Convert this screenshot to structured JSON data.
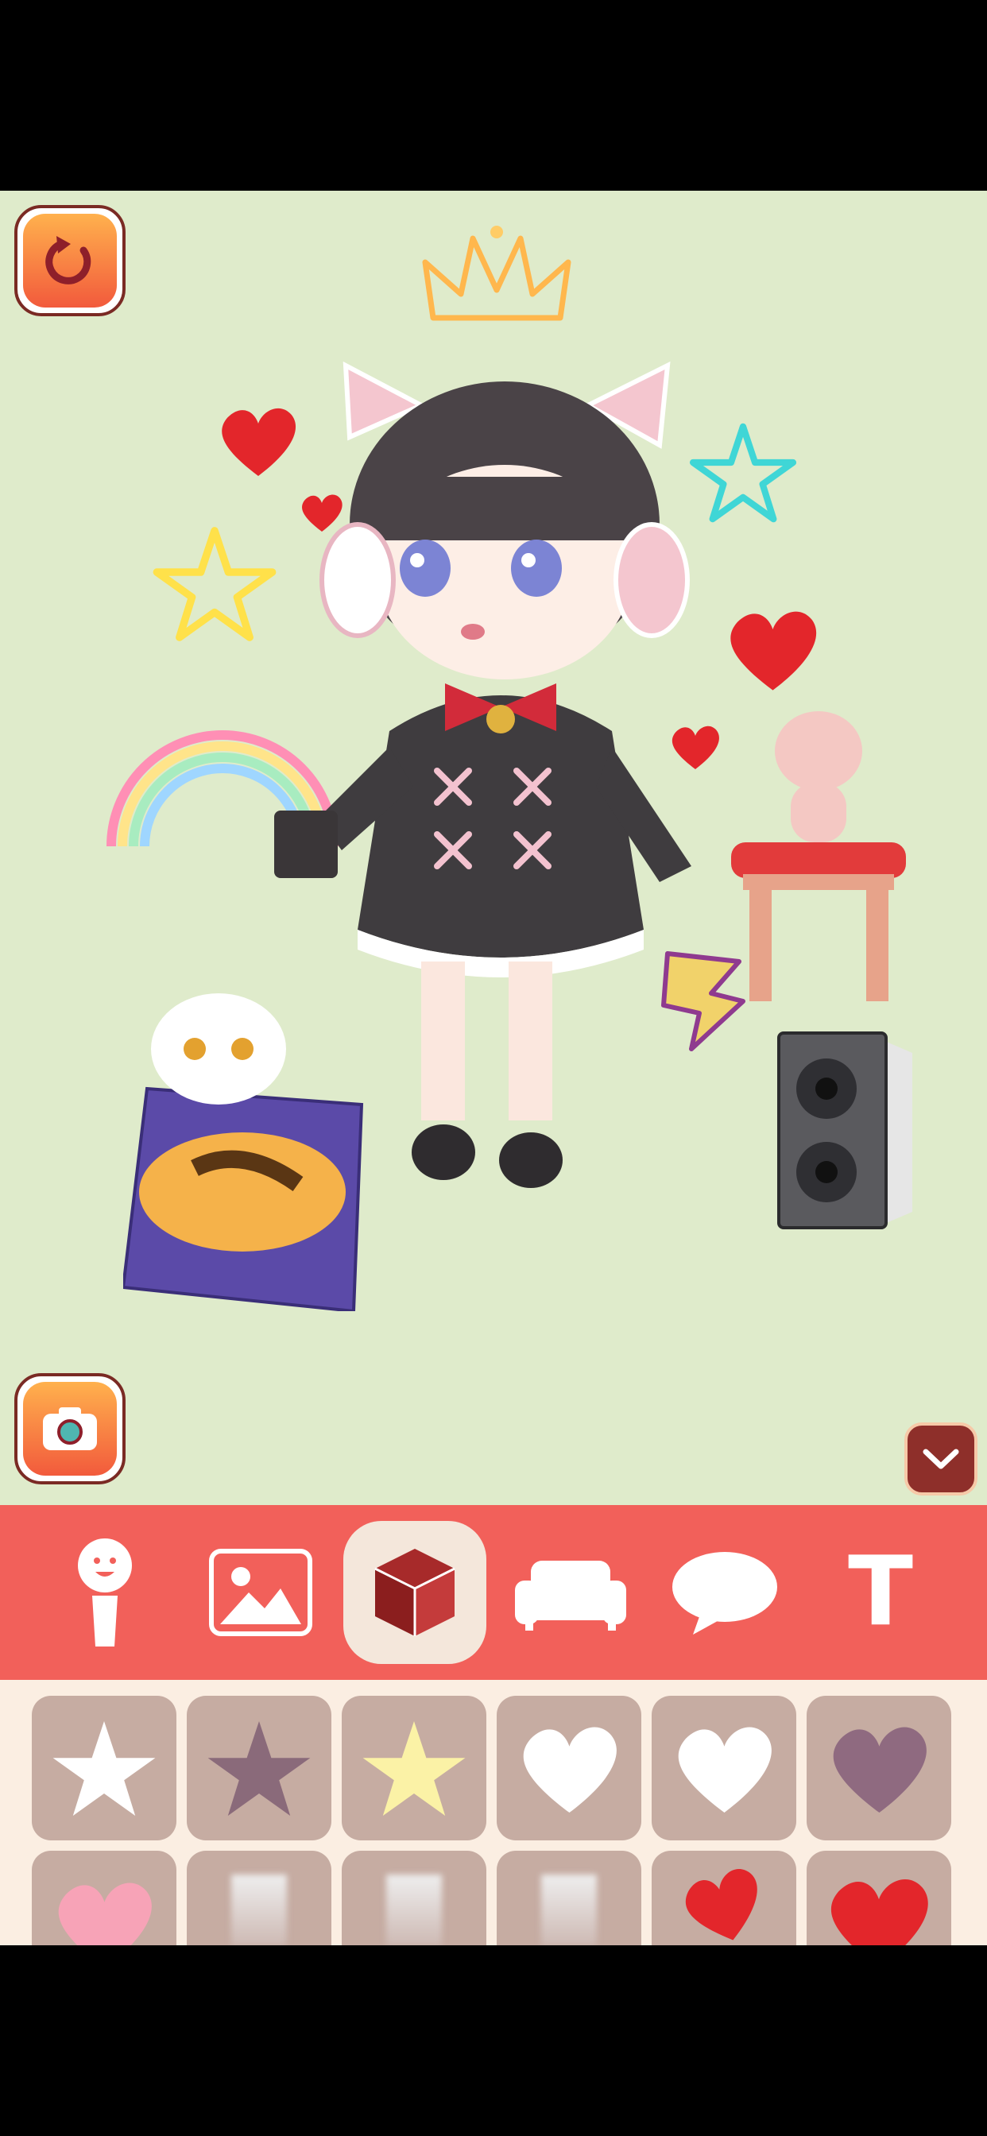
{
  "scene": {
    "background_color": "#dfebcb",
    "stickers": [
      "crown-neon",
      "heart",
      "heart",
      "heart",
      "heart",
      "star-neon-yellow",
      "star-neon-cyan",
      "rainbow",
      "chibi-girl-cat-ears",
      "calico-cat-on-cushion",
      "pink-cat-on-stool",
      "lightning-bolt",
      "speaker"
    ]
  },
  "buttons": {
    "reset_icon": "reset-icon",
    "camera_icon": "camera-icon",
    "collapse_icon": "chevron-down-icon"
  },
  "toolbar": {
    "active_index": 2,
    "tools": [
      {
        "icon": "character-icon"
      },
      {
        "icon": "background-image-icon"
      },
      {
        "icon": "item-box-icon"
      },
      {
        "icon": "sofa-icon"
      },
      {
        "icon": "speech-bubble-icon"
      },
      {
        "icon": "text-icon",
        "glyph": "T"
      }
    ]
  },
  "tray": {
    "items": [
      "star-white",
      "star-mauve",
      "star-yellow",
      "heart-white",
      "heart-white",
      "heart-mauve",
      "heart-pink",
      "blurred-item",
      "blurred-item",
      "blurred-item",
      "hearts-red",
      "heart-red"
    ]
  },
  "colors": {
    "accent": "#f2605a",
    "tray": "#fbeee2",
    "cell": "#c6aca2",
    "brown": "#7a2a24"
  }
}
